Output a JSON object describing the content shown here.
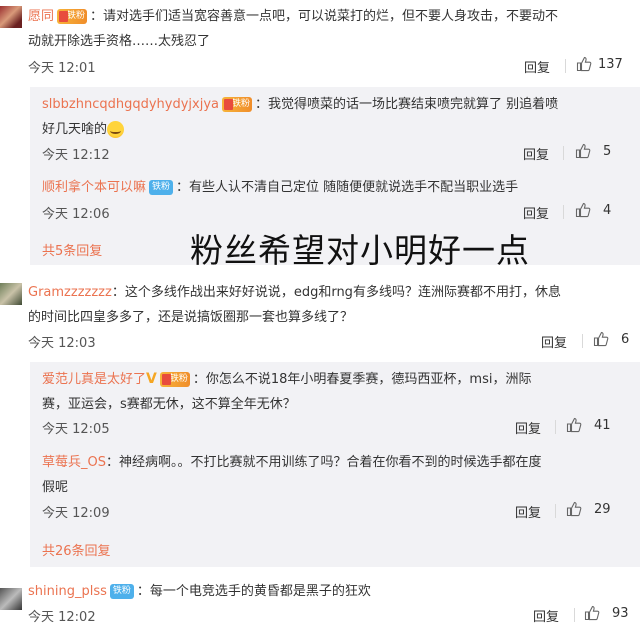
{
  "comments": [
    {
      "user": "愿同",
      "badge": "铁粉",
      "text_line1": "：请对选手们适当宽容善意一点吧，可以说菜打的烂，但不要人身攻击，不要动不",
      "text_line2": "动就开除选手资格……太残忍了",
      "time": "今天 12:01",
      "reply_label": "回复",
      "likes": "137",
      "replies": [
        {
          "user": "slbbzhncqdhgqdyhydyjxjya",
          "badge": "铁粉",
          "text_line1": "：我觉得喷菜的话一场比赛结束喷完就算了 别追着喷",
          "text_line2": "好几天啥的",
          "time": "今天 12:12",
          "reply_label": "回复",
          "likes": "5"
        },
        {
          "user": "顺利拿个本可以嘛",
          "badge": "铁粉",
          "text_line1": "：有些人认不清自己定位  随随便便就说选手不配当职业选手",
          "time": "今天 12:06",
          "reply_label": "回复",
          "likes": "4"
        }
      ],
      "more_replies": "共5条回复"
    },
    {
      "user": "Gramzzzzzzz",
      "text_line1": "：这个多线作战出来好好说说，edg和rng有多线吗？连洲际赛都不用打，休息",
      "text_line2": "的时间比四皇多多了，还是说搞饭圈那一套也算多线了？",
      "time": "今天 12:03",
      "reply_label": "回复",
      "likes": "6",
      "replies": [
        {
          "user": "爱范儿真是太好了",
          "badge": "铁粉",
          "text_line1": "：你怎么不说18年小明春夏季赛，德玛西亚杯，msi，洲际",
          "text_line2": "赛，亚运会，s赛都无休，这不算全年无休？",
          "time": "今天 12:05",
          "reply_label": "回复",
          "likes": "41"
        },
        {
          "user": "草莓兵_OS",
          "text_line1": "：神经病啊。。不打比赛就不用训练了吗？合着在你看不到的时候选手都在度",
          "text_line2": "假呢",
          "time": "今天 12:09",
          "reply_label": "回复",
          "likes": "29"
        }
      ],
      "more_replies": "共26条回复"
    },
    {
      "user": "shining_plss",
      "badge": "铁粉",
      "text_line1": "：每一个电竞选手的黄昏都是黑子的狂欢",
      "time": "今天 12:02",
      "reply_label": "回复",
      "likes": "93"
    }
  ],
  "overlay_caption": "粉丝希望对小明好一点",
  "colors": {
    "username": "#eb7350",
    "fan_badge": "#4eb0eb",
    "reply_bg": "#f2f2f5"
  },
  "icons": {
    "like": "thumbs-up-icon"
  }
}
